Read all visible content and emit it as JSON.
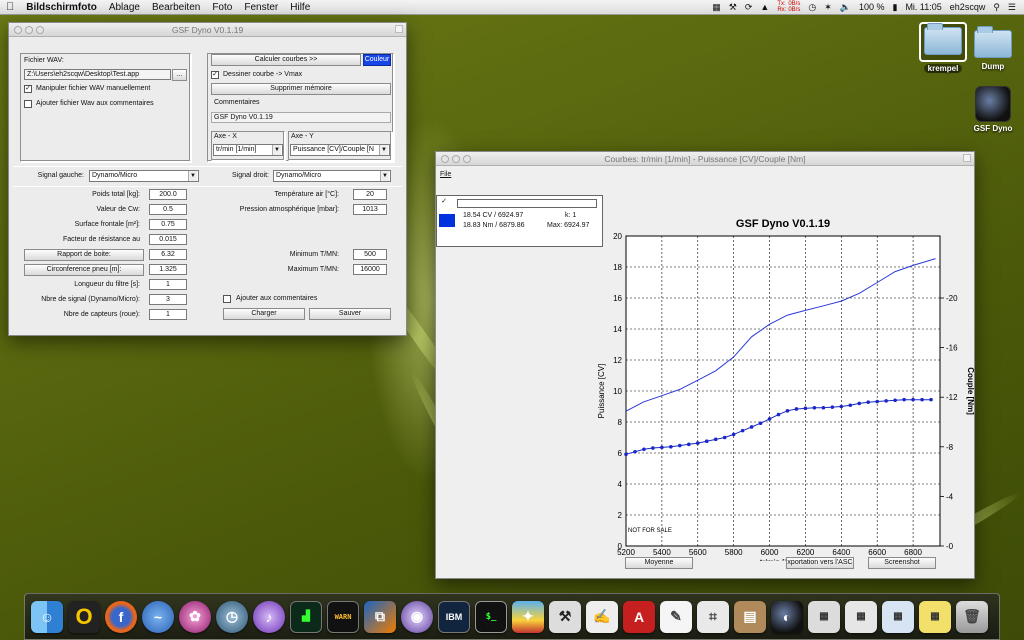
{
  "menubar": {
    "apple": "",
    "app": "Bildschirmfoto",
    "items": [
      "Ablage",
      "Bearbeiten",
      "Foto",
      "Fenster",
      "Hilfe"
    ],
    "tx": "Tx:",
    "rx": "Rx:",
    "tx_val": "0B/s",
    "rx_val": "0B/s",
    "battery": "100 %",
    "clock": "Mi. 11:05",
    "user": "eh2scqw"
  },
  "desktop": {
    "icons": [
      {
        "label": "krempel",
        "icon": "folder-icon"
      },
      {
        "label": "Dump",
        "icon": "folder-icon"
      },
      {
        "label": "GSF Dyno",
        "icon": "app-icon"
      }
    ]
  },
  "main_window": {
    "title": "GSF Dyno V0.1.19",
    "wav_label": "Fichier WAV:",
    "wav_path": "Z:\\Users\\eh2scqw\\Desktop\\Test.app",
    "browse": "...",
    "manual_wav": "Manipuler fichier WAV manuellement",
    "add_wav_comments": "Ajouter fichier Wav aux commentaires",
    "calc_curves": "Calculer courbes >>",
    "color": "Couleur",
    "draw_curve": "Dessiner courbe -> Vmax",
    "delete_memory": "Supprimer mémoire",
    "comments_label": "Commentaires",
    "comments_value": "GSF Dyno V0.1.19",
    "axis_x_label": "Axe - X",
    "axis_x_value": "tr/min [1/min]",
    "axis_y_label": "Axe - Y",
    "axis_y_value": "Puissance [CV]/Couple [N",
    "signal_left_label": "Signal gauche:",
    "signal_left_value": "Dynamo/Micro",
    "signal_right_label": "Signal droit:",
    "signal_right_value": "Dynamo/Micro",
    "params_left": [
      {
        "label": "Poids total [kg]:",
        "value": "200.0",
        "button": false
      },
      {
        "label": "Valeur de Cw:",
        "value": "0.5",
        "button": false
      },
      {
        "label": "Surface frontale [m²]:",
        "value": "0.75",
        "button": false
      },
      {
        "label": "Facteur de résistance au",
        "value": "0.015",
        "button": false
      },
      {
        "label": "Rapport de boite:",
        "value": "6.32",
        "button": true
      },
      {
        "label": "Circonference pneu [m]:",
        "value": "1.325",
        "button": true
      },
      {
        "label": "Longueur du filtre [s]:",
        "value": "1",
        "button": false
      },
      {
        "label": "Nbre de signal (Dynamo/Micro):",
        "value": "3",
        "button": false
      },
      {
        "label": "Nbre de capteurs (roue):",
        "value": "1",
        "button": false
      }
    ],
    "temp_label": "Température air [°C]:",
    "temp_value": "20",
    "pressure_label": "Pression atmosphérique [mbar]:",
    "pressure_value": "1013",
    "min_rpm_label": "Minimum T/MN:",
    "min_rpm_value": "500",
    "max_rpm_label": "Maximum T/MN:",
    "max_rpm_value": "16000",
    "add_comments": "Ajouter aux commentaires",
    "load": "Charger",
    "save": "Sauver"
  },
  "chart_window": {
    "title": "Courbes: tr/min [1/min] - Puissance [CV]/Couple [Nm]",
    "menu_file": "File",
    "legend": {
      "line1": "18.54 CV / 6924.97",
      "line2": "18.83 Nm / 6879.86",
      "k": "k: 1",
      "max": "Max: 6924.97",
      "swatch_color": "#0033dd"
    },
    "not_for_sale": "NOT FOR SALE",
    "buttons": [
      "Moyenne",
      "xportation vers l'ASC",
      "Screenshot"
    ]
  },
  "chart_data": {
    "type": "line",
    "title": "GSF Dyno V0.1.19",
    "xlabel": "tr/min [1/min]",
    "ylabel": "Puissance [CV]",
    "y2label": "Couple [Nm]",
    "xlim": [
      5200,
      6950
    ],
    "ylim": [
      0,
      20
    ],
    "y2lim": [
      0,
      25
    ],
    "xticks": [
      5200,
      5400,
      5600,
      5800,
      6000,
      6200,
      6400,
      6600,
      6800
    ],
    "yticks": [
      0,
      2,
      4,
      6,
      8,
      10,
      12,
      14,
      16,
      18,
      20
    ],
    "y2ticks": [
      0,
      4,
      8,
      12,
      16,
      20
    ],
    "grid": true,
    "series": [
      {
        "axis": "left",
        "color": "#2a3ad8",
        "markers": false,
        "x": [
          5200,
          5300,
          5400,
          5500,
          5600,
          5700,
          5800,
          5900,
          6000,
          6100,
          6200,
          6300,
          6400,
          6500,
          6600,
          6700,
          6800,
          6900,
          6925
        ],
        "y": [
          8.7,
          9.3,
          9.7,
          10.1,
          10.7,
          11.3,
          12.2,
          13.5,
          14.3,
          14.9,
          15.2,
          15.5,
          15.8,
          16.3,
          17.0,
          17.7,
          18.1,
          18.45,
          18.54
        ]
      },
      {
        "axis": "right",
        "color": "#1a28c8",
        "markers": true,
        "x": [
          5200,
          5250,
          5300,
          5350,
          5400,
          5450,
          5500,
          5550,
          5600,
          5650,
          5700,
          5750,
          5800,
          5850,
          5900,
          5950,
          6000,
          6050,
          6100,
          6150,
          6200,
          6250,
          6300,
          6350,
          6400,
          6450,
          6500,
          6550,
          6600,
          6650,
          6700,
          6750,
          6800,
          6850,
          6900
        ],
        "y": [
          7.4,
          7.6,
          7.8,
          7.9,
          7.95,
          8.0,
          8.1,
          8.2,
          8.3,
          8.45,
          8.6,
          8.75,
          9.0,
          9.3,
          9.6,
          9.9,
          10.25,
          10.6,
          10.9,
          11.05,
          11.1,
          11.15,
          11.15,
          11.2,
          11.25,
          11.35,
          11.5,
          11.6,
          11.65,
          11.7,
          11.75,
          11.8,
          11.8,
          11.8,
          11.8
        ]
      }
    ]
  }
}
